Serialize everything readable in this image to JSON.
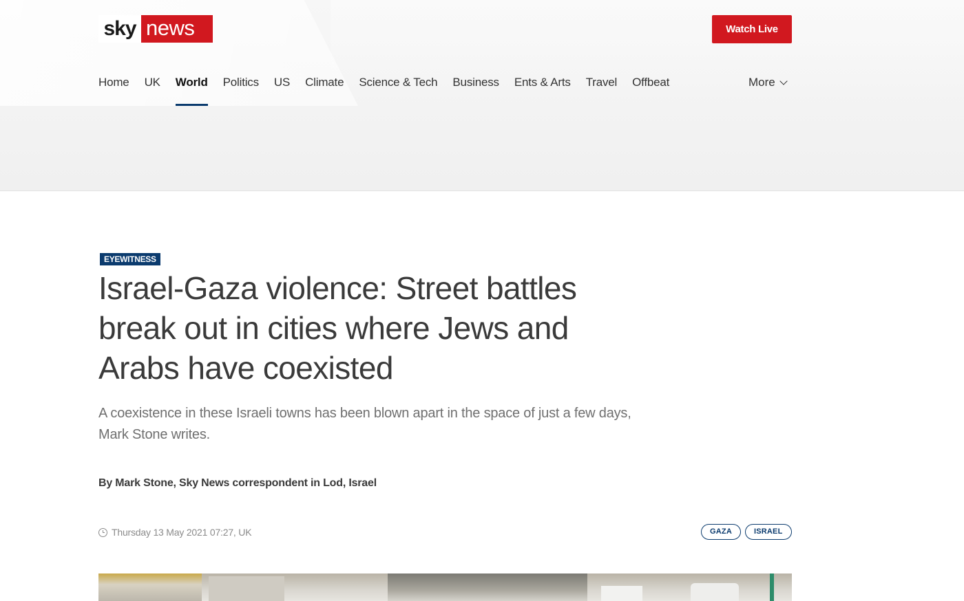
{
  "header": {
    "logo": {
      "left": "sky",
      "right": "news"
    },
    "watch_live_label": "Watch Live",
    "nav": [
      {
        "label": "Home",
        "active": false
      },
      {
        "label": "UK",
        "active": false
      },
      {
        "label": "World",
        "active": true
      },
      {
        "label": "Politics",
        "active": false
      },
      {
        "label": "US",
        "active": false
      },
      {
        "label": "Climate",
        "active": false
      },
      {
        "label": "Science & Tech",
        "active": false
      },
      {
        "label": "Business",
        "active": false
      },
      {
        "label": "Ents & Arts",
        "active": false
      },
      {
        "label": "Travel",
        "active": false
      },
      {
        "label": "Offbeat",
        "active": false
      }
    ],
    "more_label": "More",
    "more_icon": "chevron-down-icon"
  },
  "article": {
    "badge": "EYEWITNESS",
    "headline": "Israel-Gaza violence: Street battles break out in cities where Jews and Arabs have coexisted",
    "standfirst": "A coexistence in these Israeli towns has been blown apart in the space of just a few days, Mark Stone writes.",
    "byline": "By Mark Stone, Sky News correspondent in Lod, Israel",
    "date": "Thursday 13 May 2021 07:27, UK",
    "date_icon": "clock-icon",
    "tags": [
      "GAZA",
      "ISRAEL"
    ]
  },
  "colors": {
    "brand_red": "#d1181f",
    "navy": "#0b3b6e",
    "header_bg": "#f2f2f2"
  }
}
